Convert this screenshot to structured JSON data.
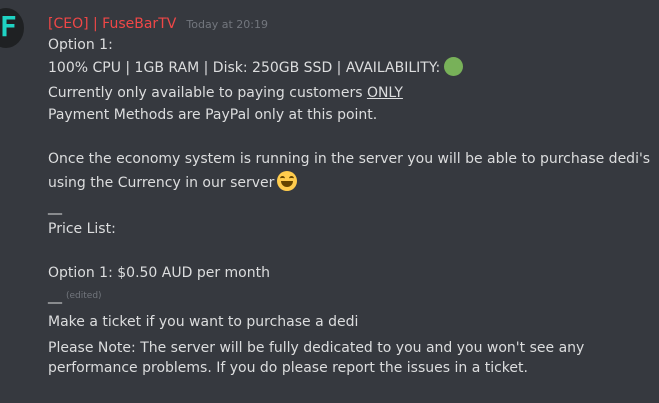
{
  "message": {
    "avatar_letter": "F",
    "username": "[CEO] | FuseBarTV",
    "timestamp": "Today at 20:19",
    "lines": {
      "l1": "Option 1:",
      "l2": "100% CPU | 1GB RAM | Disk: 250GB SSD | AVAILABILITY:",
      "l3_a": "Currently only available to paying customers ",
      "l3_b": "ONLY",
      "l4": "Payment Methods are PayPal only at this point.",
      "l5": "Once the economy system is running in the server you will be able to purchase dedi's",
      "l6": "using the Currency in our server",
      "l7": "__",
      "l8": "Price List:",
      "l9": "Option 1: $0.50 AUD per month",
      "l10": "__",
      "l10_edited": "(edited)",
      "l11": "Make a ticket if you want to purchase a dedi",
      "l12": "Please Note: The server will be fully dedicated to you and you won't see any",
      "l13": "performance problems. If you do please report the issues in a ticket."
    },
    "emoji": {
      "availability": "green-circle",
      "smile": "grinning-face-with-smiling-eyes"
    },
    "colors": {
      "background": "#36393f",
      "username": "#f04747",
      "text": "#dcddde",
      "muted": "#72767d",
      "availability": "#78b159"
    }
  }
}
